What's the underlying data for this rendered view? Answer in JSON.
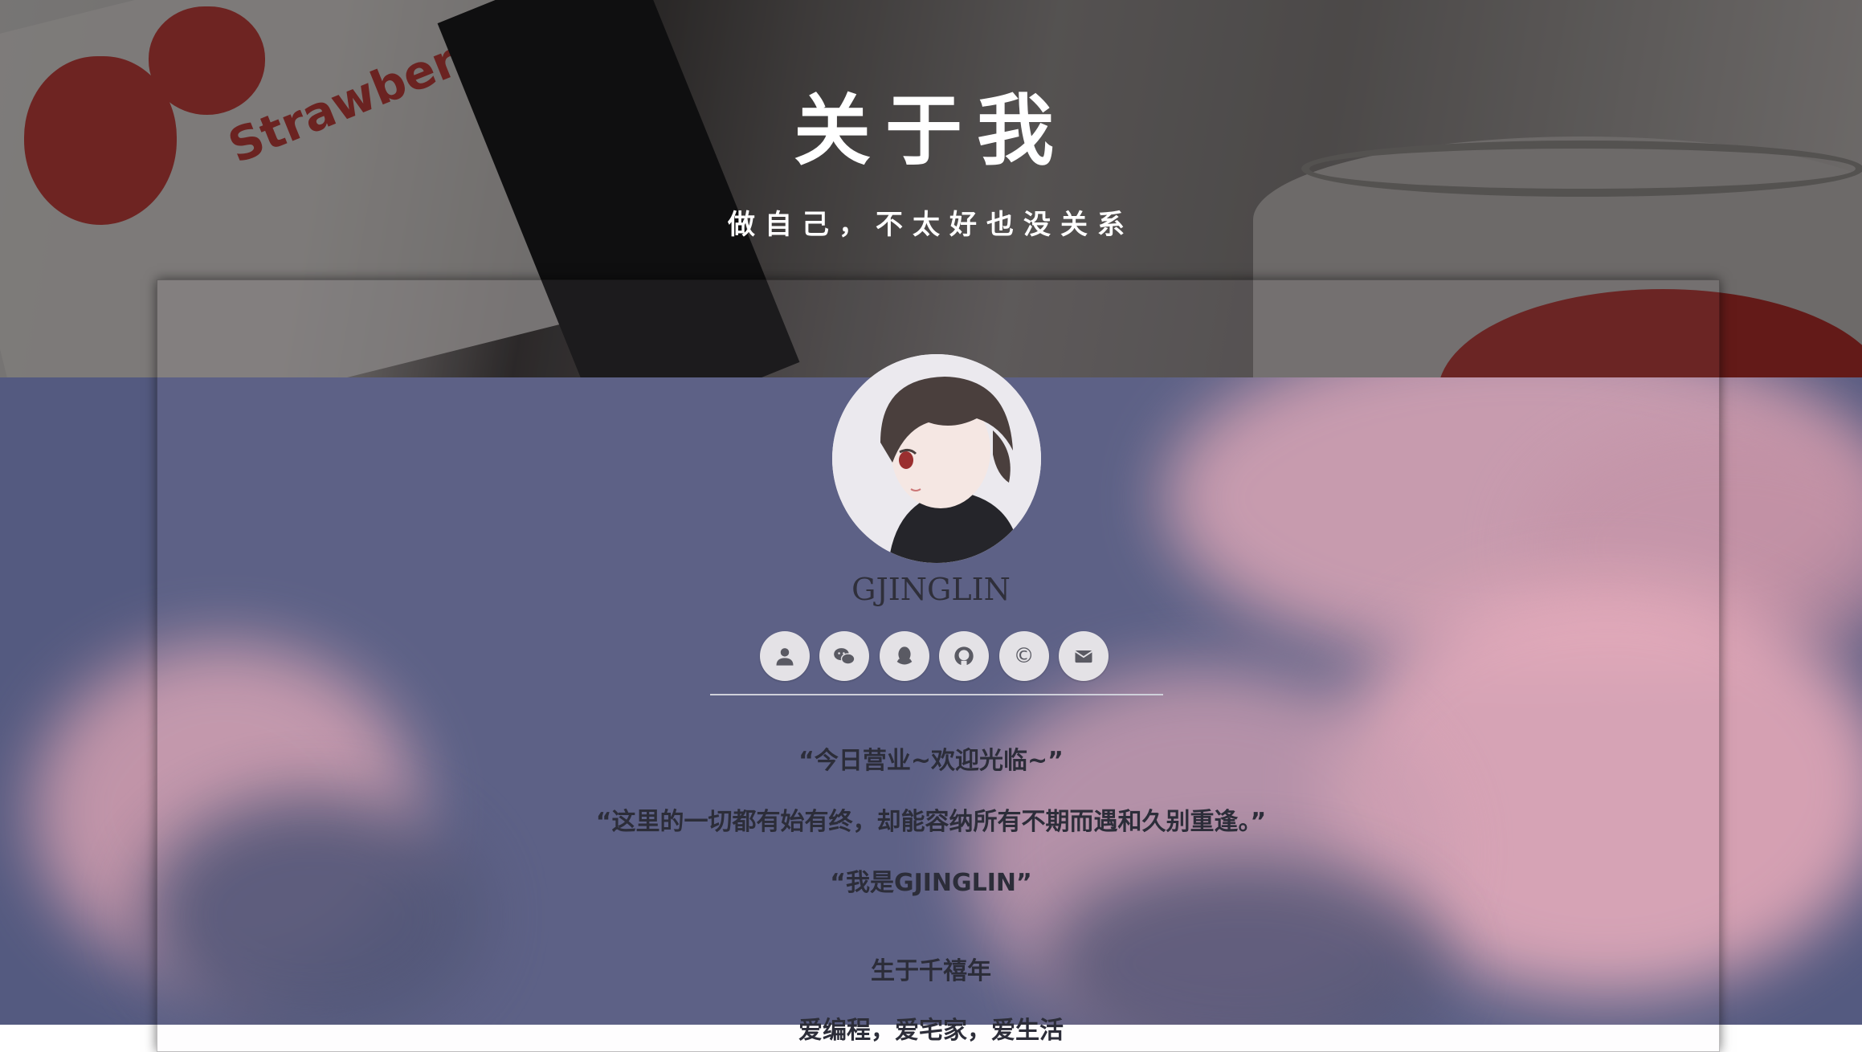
{
  "hero": {
    "title": "关于我",
    "subtitle": "做自己，不太好也没关系",
    "decor_text": "Strawberry 7%"
  },
  "profile": {
    "name": "GJINGLIN",
    "social_icons": [
      "user-icon",
      "wechat-icon",
      "qq-icon",
      "github-icon",
      "copyright-icon",
      "envelope-icon"
    ]
  },
  "about": {
    "line1": "“今日营业~欢迎光临~”",
    "line2": "“这里的一切都有始有终，却能容纳所有不期而遇和久别重逢。”",
    "line3": "“我是GJINGLIN”",
    "line4": "生于千禧年",
    "line5": "爱编程，爱宅家，爱生活"
  },
  "colors": {
    "card_overlay": "#e6e4eb",
    "text": "#2c2d39",
    "icon_bg": "#e4e2e6",
    "sky": "#545a80",
    "cloud_pink": "#d9a2b2"
  }
}
